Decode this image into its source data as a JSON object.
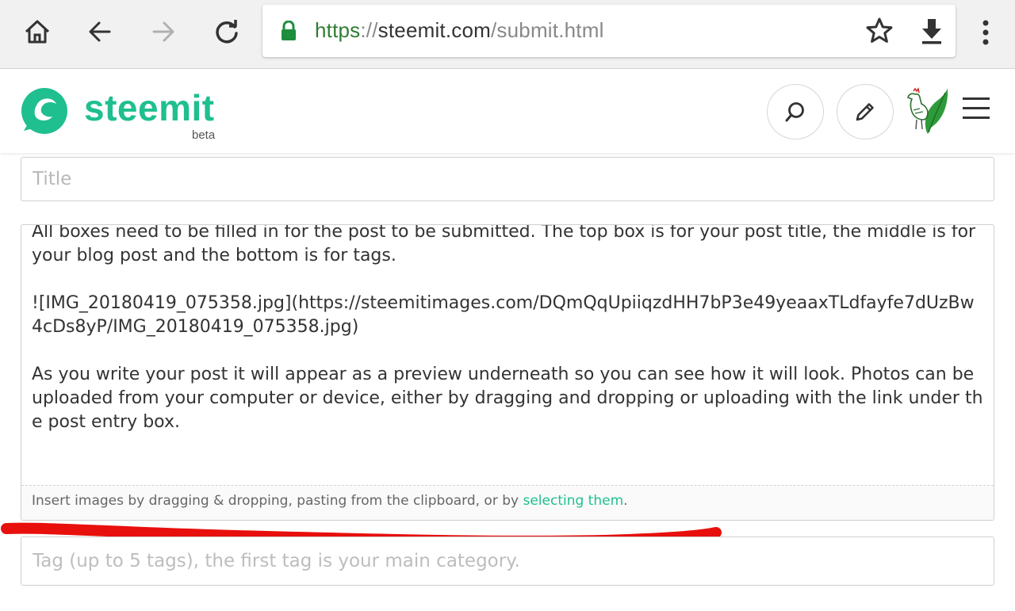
{
  "browser": {
    "url_scheme": "https",
    "url_separator": "://",
    "url_host": "steemit.com",
    "url_path": "/submit.html",
    "colors": {
      "secure": "#2e7d32",
      "toolbar": "#f1f1f1"
    },
    "icons": [
      "home-icon",
      "back-icon",
      "forward-icon",
      "reload-icon",
      "lock-icon",
      "star-icon",
      "download-icon",
      "more-vert-icon"
    ]
  },
  "header": {
    "brand": "steemit",
    "beta": "beta",
    "brand_color": "#1fbf8f",
    "icons": [
      "search-icon",
      "pencil-icon",
      "avatar-icon",
      "hamburger-icon"
    ]
  },
  "form": {
    "title_placeholder": "Title",
    "body_paragraphs": [
      "All boxes need to be filled in for the post to be submitted. The top box is for your post title, the middle is for your blog post and the bottom is for tags.",
      "![IMG_20180419_075358.jpg](https://steemitimages.com/DQmQqUpiiqzdHH7bP3e49yeaaxTLdfayfe7dUzBw4cDs8yP/IMG_20180419_075358.jpg)",
      "As you write your post it will appear as a preview underneath so you can see how it will look. Photos can be uploaded from your computer or device, either by dragging and dropping or uploading with the link under the post entry box."
    ],
    "dropzone_text": "Insert images by dragging & dropping, pasting from the clipboard, or by ",
    "dropzone_link": "selecting them",
    "dropzone_end": ".",
    "tags_placeholder": "Tag (up to 5 tags), the first tag is your main category.",
    "annotation_color": "#e8100c"
  }
}
